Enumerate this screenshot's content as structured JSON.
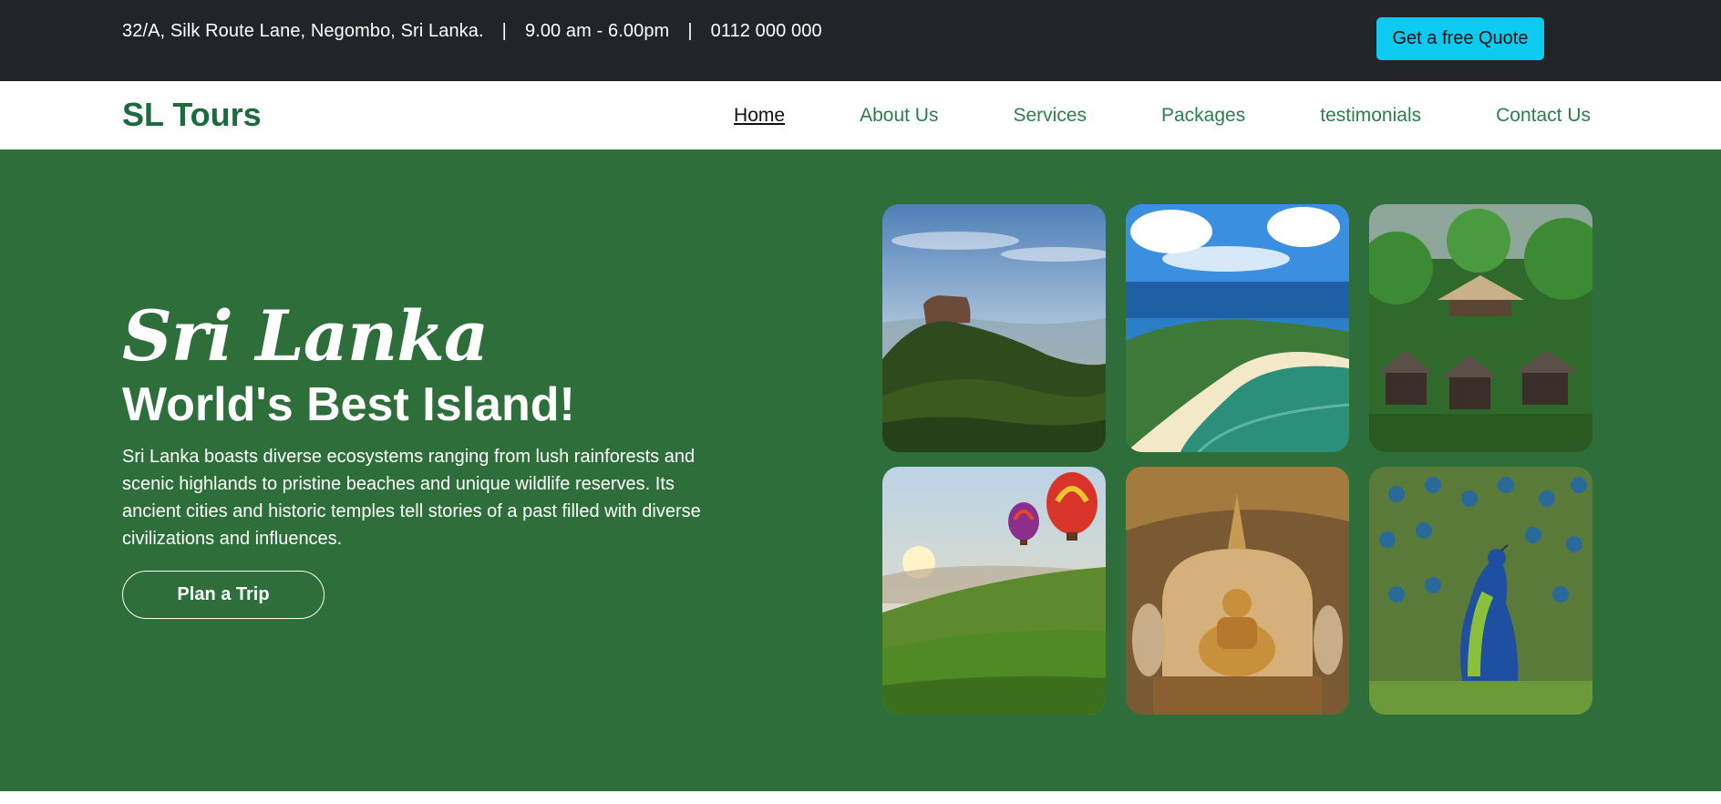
{
  "topbar": {
    "address": "32/A, Silk Route Lane, Negombo, Sri Lanka.",
    "hours": "9.00 am - 6.00pm",
    "phone": "0112 000 000",
    "separator": "|",
    "quote_button": "Get a free Quote"
  },
  "navbar": {
    "brand": "SL Tours",
    "links": [
      "Home",
      "About Us",
      "Services",
      "Packages",
      "testimonials",
      "Contact Us"
    ],
    "active": "Home"
  },
  "hero": {
    "title": "Sri Lanka",
    "subtitle": "World's Best Island!",
    "description": "Sri Lanka boasts diverse ecosystems ranging from lush rainforests and scenic highlands to pristine beaches and unique wildlife reserves. Its ancient cities and historic temples tell stories of a past filled with diverse civilizations and influences.",
    "cta": "Plan a Trip"
  },
  "gallery": {
    "images": [
      "sigiriya-rock-photo",
      "coastal-island-photo",
      "jungle-lodge-photo",
      "tea-hills-balloons-photo",
      "buddha-cave-temple-photo",
      "peacock-photo"
    ]
  },
  "colors": {
    "topbar_bg": "#212529",
    "hero_bg": "#2d6e3a",
    "brand": "#1c6b3e",
    "quote_button": "#0dcaf0"
  }
}
